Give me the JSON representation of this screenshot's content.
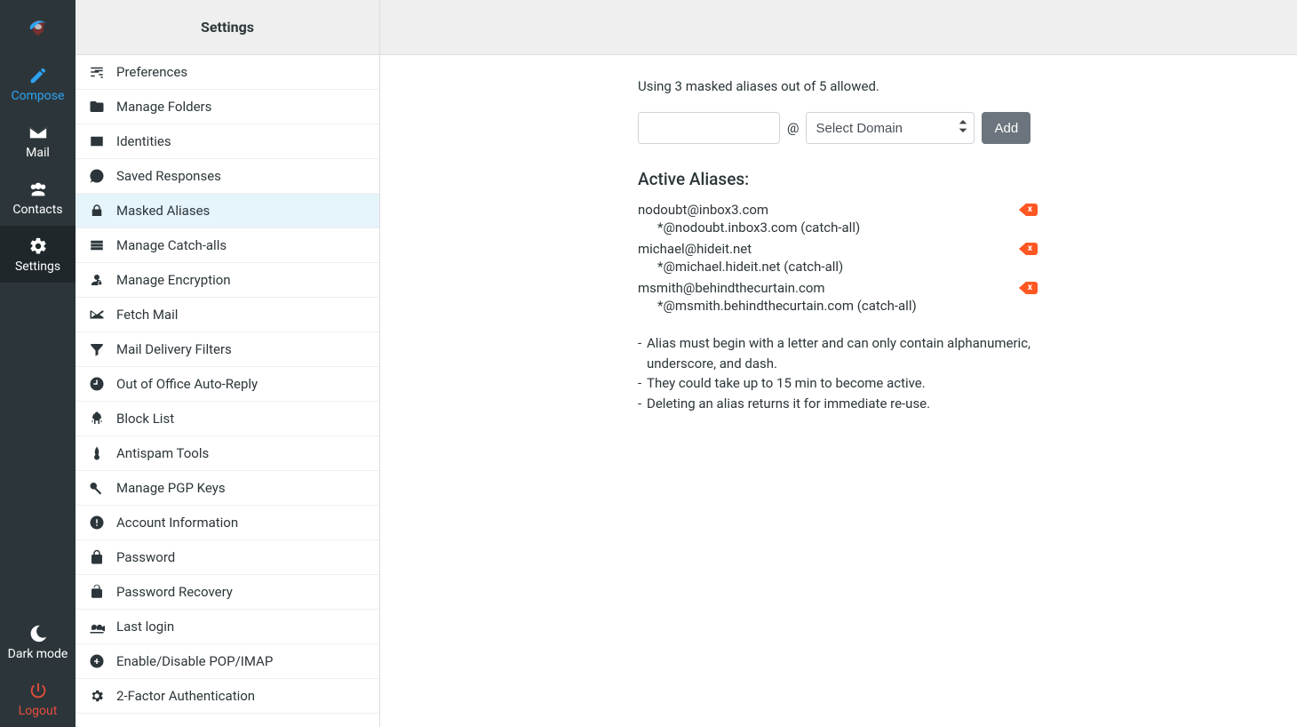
{
  "nav": {
    "compose": "Compose",
    "mail": "Mail",
    "contacts": "Contacts",
    "settings": "Settings",
    "darkmode": "Dark mode",
    "logout": "Logout"
  },
  "settings_panel": {
    "title": "Settings",
    "items": [
      "Preferences",
      "Manage Folders",
      "Identities",
      "Saved Responses",
      "Masked Aliases",
      "Manage Catch-alls",
      "Manage Encryption",
      "Fetch Mail",
      "Mail Delivery Filters",
      "Out of Office Auto-Reply",
      "Block List",
      "Antispam Tools",
      "Manage PGP Keys",
      "Account Information",
      "Password",
      "Password Recovery",
      "Last login",
      "Enable/Disable POP/IMAP",
      "2-Factor Authentication"
    ],
    "active_index": 4
  },
  "content": {
    "usage_text": "Using 3 masked aliases out of 5 allowed.",
    "at_symbol": "@",
    "domain_placeholder": "Select Domain",
    "add_button": "Add",
    "section_title": "Active Aliases:",
    "aliases": [
      {
        "email": "nodoubt@inbox3.com",
        "catchall": "*@nodoubt.inbox3.com (catch-all)"
      },
      {
        "email": "michael@hideit.net",
        "catchall": "*@michael.hideit.net (catch-all)"
      },
      {
        "email": "msmith@behindthecurtain.com",
        "catchall": "*@msmith.behindthecurtain.com (catch-all)"
      }
    ],
    "delete_label": "x",
    "rules": [
      "Alias must begin with a letter and can only contain alphanumeric, underscore, and dash.",
      "They could take up to 15 min to become active.",
      "Deleting an alias returns it for immediate re-use."
    ]
  }
}
